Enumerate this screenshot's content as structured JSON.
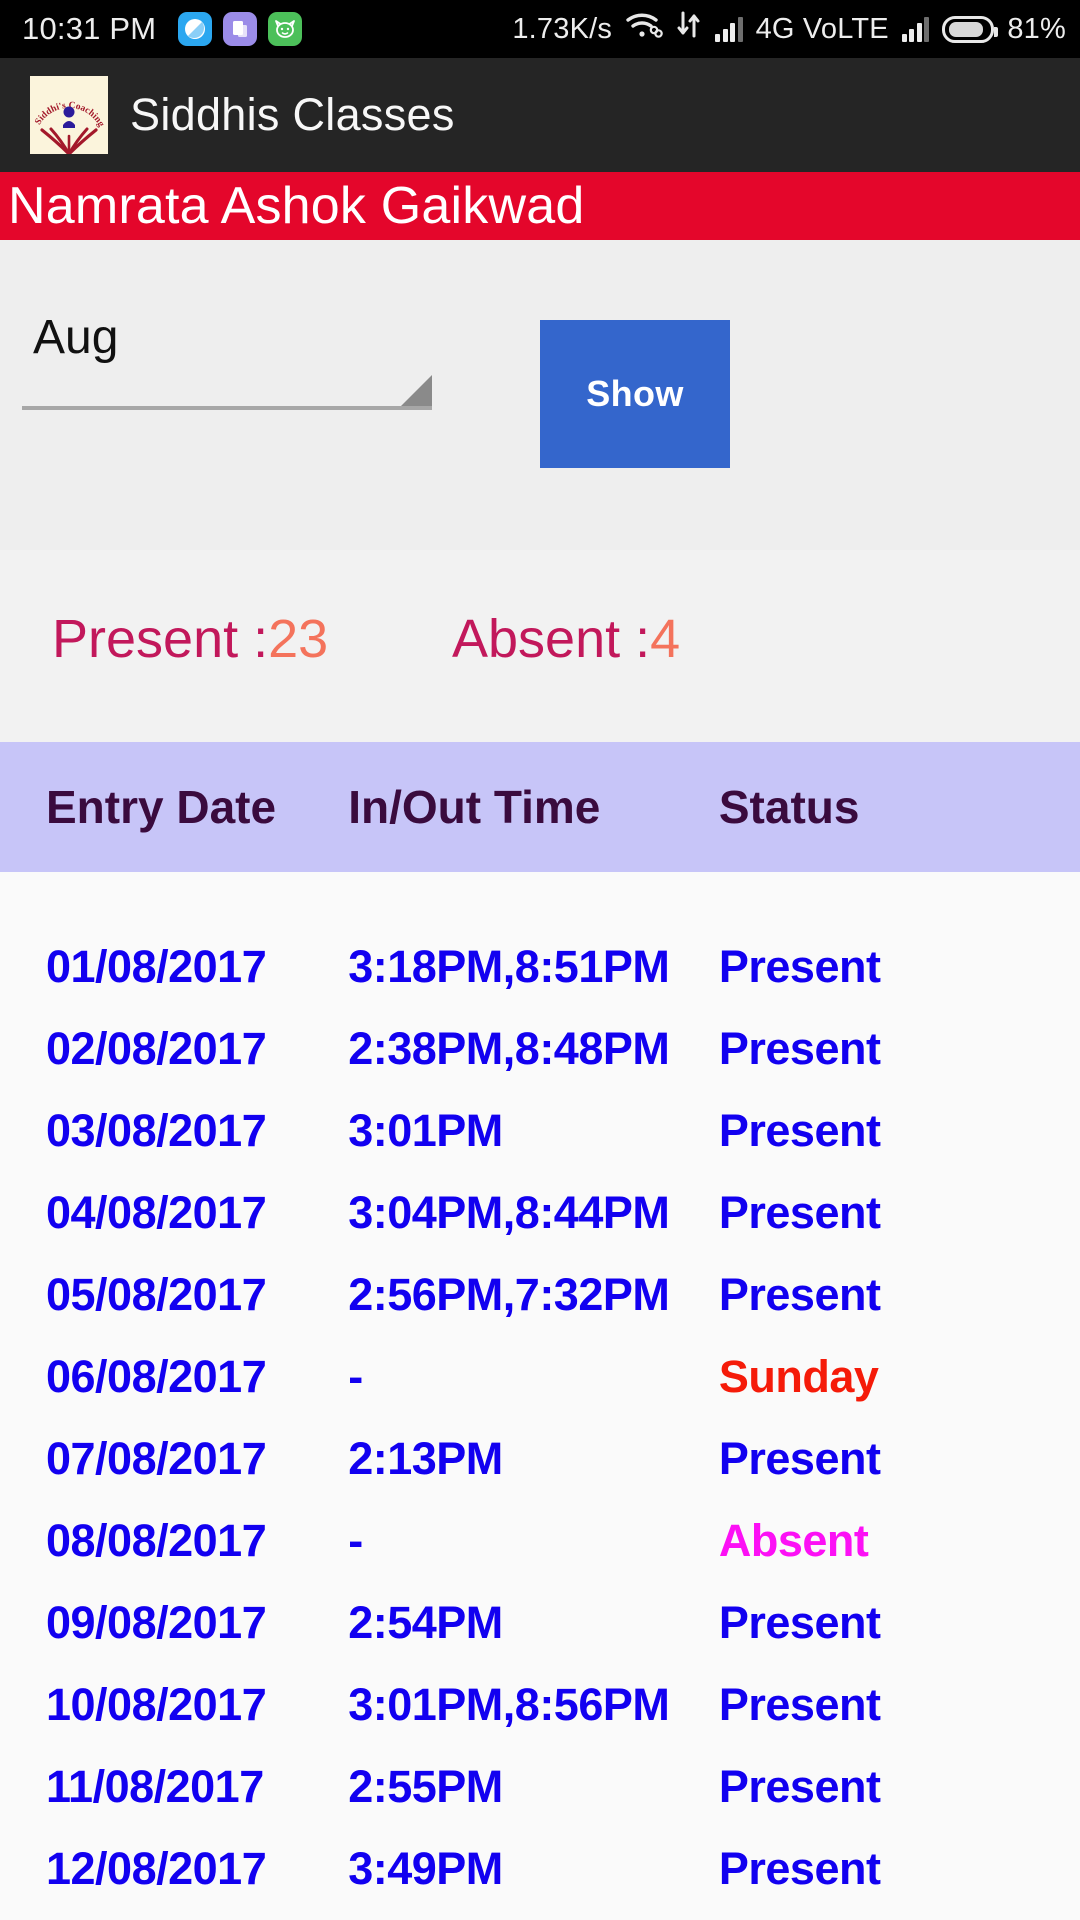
{
  "statusbar": {
    "time": "10:31 PM",
    "network_speed": "1.73K/s",
    "network_type": "4G  VoLTE",
    "battery_percent": "81%",
    "notification_icons": [
      "messenger-icon",
      "files-icon",
      "whatsapp-icon"
    ],
    "icons": [
      "wifi-icon",
      "data-transfer-icon",
      "signal-bars-icon",
      "signal-bars-2-icon",
      "battery-icon"
    ]
  },
  "appbar": {
    "title": "Siddhis Classes",
    "logo_text": "Siddhi's Coaching Classes",
    "background": "#252525"
  },
  "student": {
    "name": "Namrata Ashok Gaikwad",
    "banner_color": "#E4062B"
  },
  "filter": {
    "month_selected": "Aug",
    "show_label": "Show",
    "show_button_color": "#3466CC"
  },
  "summary": {
    "present_label": "Present :",
    "present_count": "23",
    "absent_label": "Absent :",
    "absent_count": "4",
    "label_color": "#C2185B",
    "count_color": "#F4735C"
  },
  "table": {
    "header_background": "#C7C5F8",
    "header_text_color": "#3A0B3E",
    "columns": [
      "Entry Date",
      "In/Out Time",
      "Status"
    ],
    "status_colors": {
      "Present": "#1200F0",
      "Sunday": "#F51B09",
      "Absent": "#FC10F5"
    },
    "rows": [
      {
        "date": "01/08/2017",
        "time": "3:18PM,8:51PM",
        "status": "Present"
      },
      {
        "date": "02/08/2017",
        "time": "2:38PM,8:48PM",
        "status": "Present"
      },
      {
        "date": "03/08/2017",
        "time": "3:01PM",
        "status": "Present"
      },
      {
        "date": "04/08/2017",
        "time": "3:04PM,8:44PM",
        "status": "Present"
      },
      {
        "date": "05/08/2017",
        "time": "2:56PM,7:32PM",
        "status": "Present"
      },
      {
        "date": "06/08/2017",
        "time": "-",
        "status": "Sunday"
      },
      {
        "date": "07/08/2017",
        "time": "2:13PM",
        "status": "Present"
      },
      {
        "date": "08/08/2017",
        "time": "-",
        "status": "Absent"
      },
      {
        "date": "09/08/2017",
        "time": "2:54PM",
        "status": "Present"
      },
      {
        "date": "10/08/2017",
        "time": "3:01PM,8:56PM",
        "status": "Present"
      },
      {
        "date": "11/08/2017",
        "time": "2:55PM",
        "status": "Present"
      },
      {
        "date": "12/08/2017",
        "time": "3:49PM",
        "status": "Present"
      }
    ]
  }
}
